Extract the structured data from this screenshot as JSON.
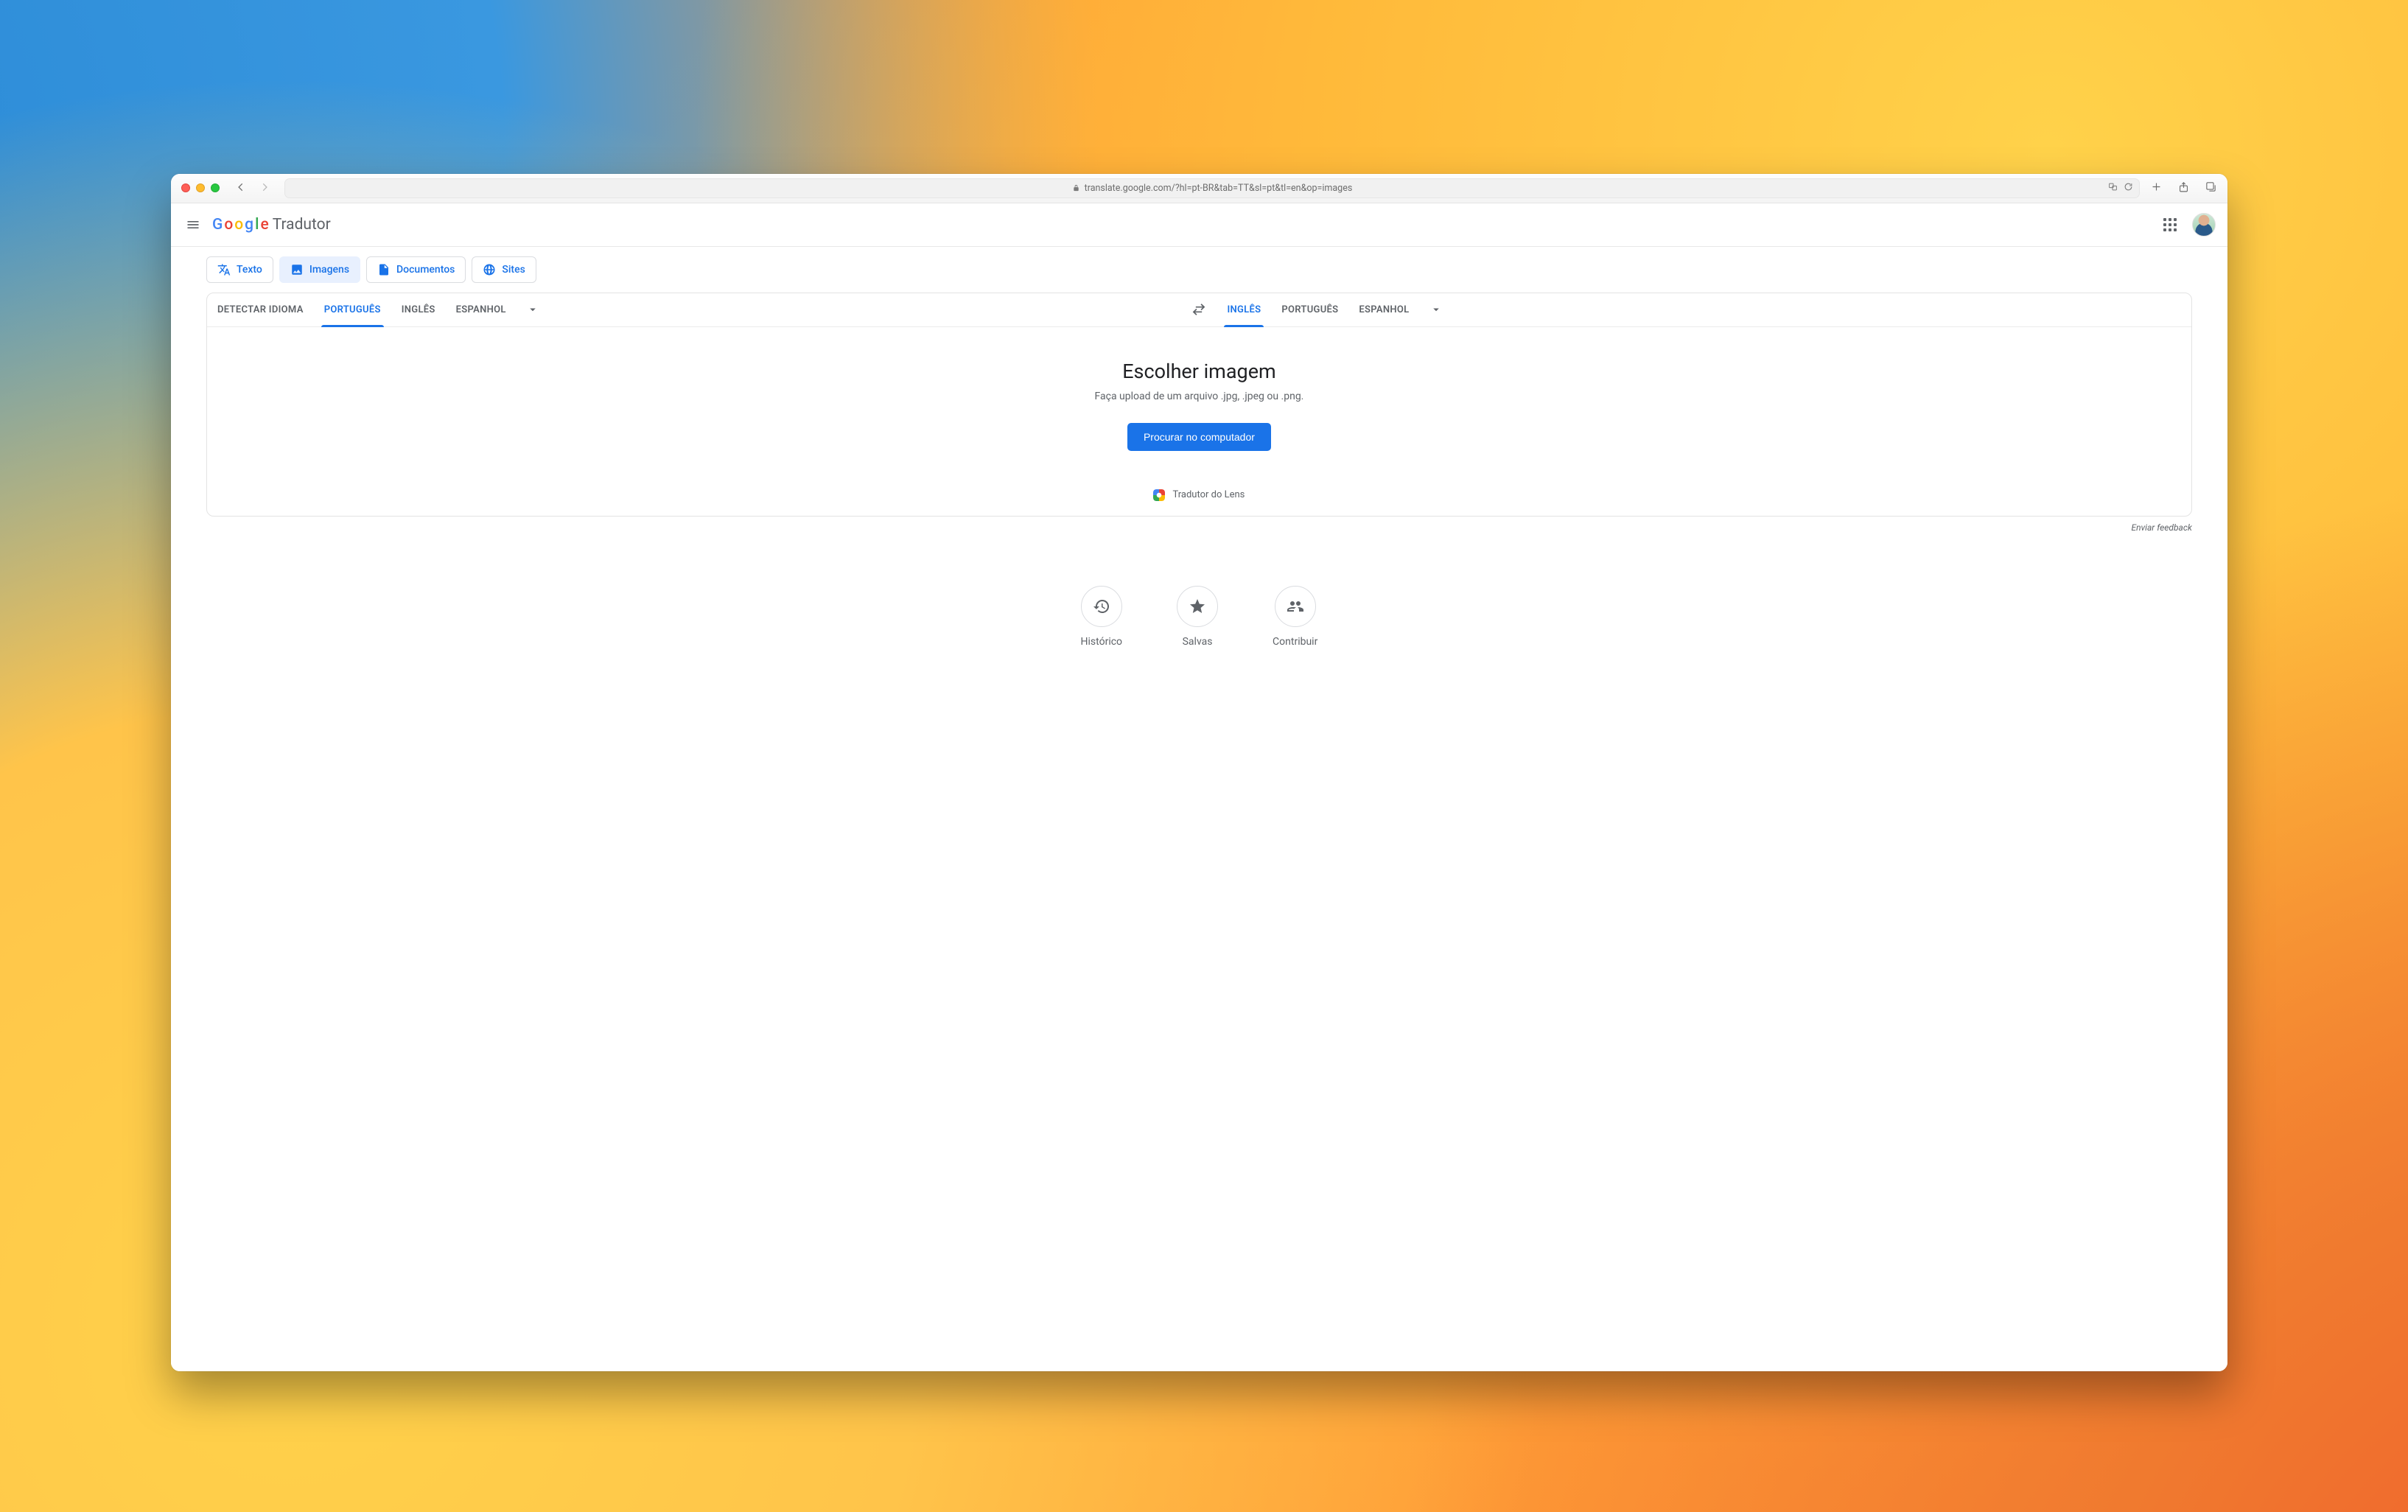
{
  "browser": {
    "url": "translate.google.com/?hl=pt-BR&tab=TT&sl=pt&tl=en&op=images"
  },
  "header": {
    "logo_letters": [
      "G",
      "o",
      "o",
      "g",
      "l",
      "e"
    ],
    "product": "Tradutor"
  },
  "modes": {
    "text": "Texto",
    "images": "Imagens",
    "documents": "Documentos",
    "sites": "Sites",
    "active": "images"
  },
  "languages": {
    "source": {
      "detect": "DETECTAR IDIOMA",
      "options": [
        "PORTUGUÊS",
        "INGLÊS",
        "ESPANHOL"
      ],
      "active": "PORTUGUÊS"
    },
    "target": {
      "options": [
        "INGLÊS",
        "PORTUGUÊS",
        "ESPANHOL"
      ],
      "active": "INGLÊS"
    }
  },
  "upload": {
    "title": "Escolher imagem",
    "subtitle": "Faça upload de um arquivo .jpg, .jpeg ou .png.",
    "button": "Procurar no computador",
    "lens": "Tradutor do Lens"
  },
  "feedback": "Enviar feedback",
  "quick": {
    "history": "Histórico",
    "saved": "Salvas",
    "contribute": "Contribuir"
  }
}
